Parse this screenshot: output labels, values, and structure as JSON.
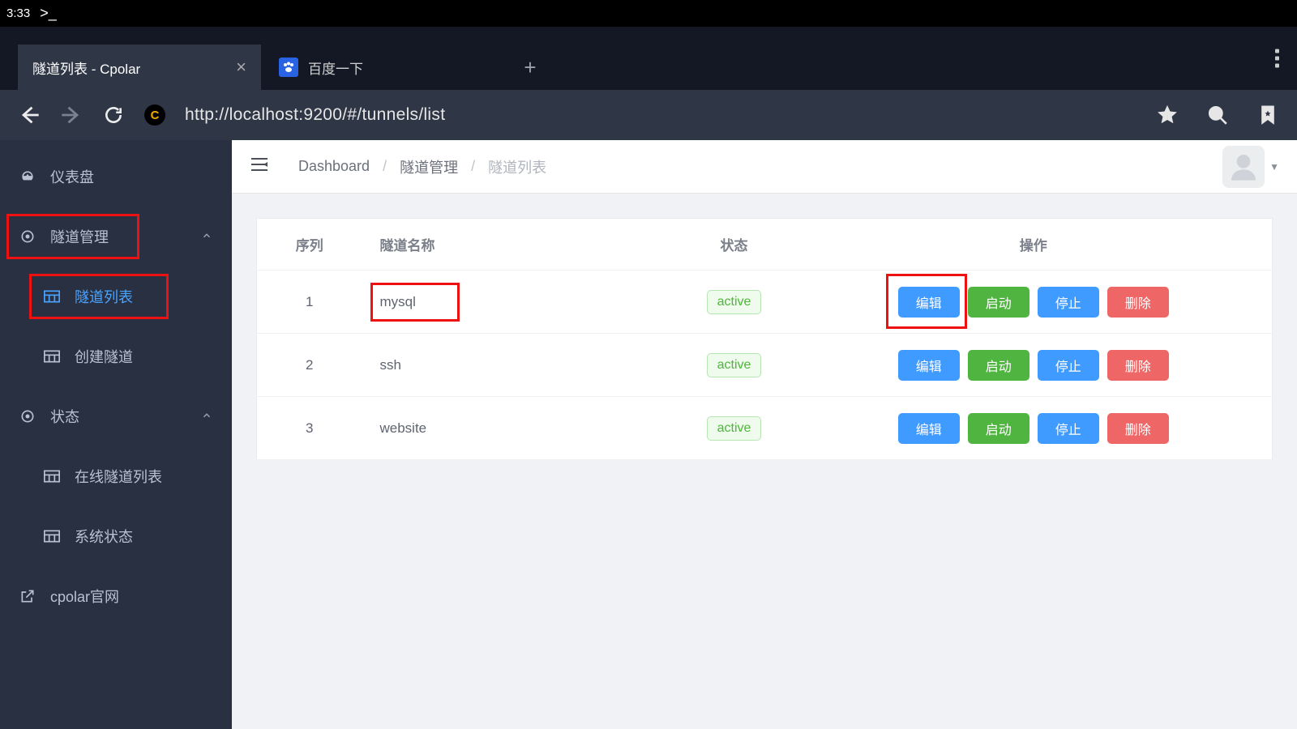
{
  "status_bar": {
    "time": "3:33",
    "prompt": ">_"
  },
  "browser": {
    "tabs": [
      {
        "title": "隧道列表 - Cpolar",
        "active": true
      },
      {
        "title": "百度一下",
        "active": false
      }
    ],
    "url": "http://localhost:9200/#/tunnels/list"
  },
  "sidebar": {
    "dashboard": "仪表盘",
    "tunnel_mgmt": "隧道管理",
    "tunnel_list": "隧道列表",
    "create_tunnel": "创建隧道",
    "status": "状态",
    "online_tunnels": "在线隧道列表",
    "system_status": "系统状态",
    "cpolar_site": "cpolar官网"
  },
  "breadcrumb": {
    "dashboard": "Dashboard",
    "tunnel_mgmt": "隧道管理",
    "tunnel_list": "隧道列表"
  },
  "table": {
    "headers": {
      "index": "序列",
      "name": "隧道名称",
      "status": "状态",
      "ops": "操作"
    },
    "status_label": "active",
    "op_labels": {
      "edit": "编辑",
      "start": "启动",
      "stop": "停止",
      "delete": "删除"
    },
    "rows": [
      {
        "index": "1",
        "name": "mysql",
        "status": "active",
        "highlight_name": true,
        "highlight_edit": true
      },
      {
        "index": "2",
        "name": "ssh",
        "status": "active",
        "highlight_name": false,
        "highlight_edit": false
      },
      {
        "index": "3",
        "name": "website",
        "status": "active",
        "highlight_name": false,
        "highlight_edit": false
      }
    ]
  }
}
